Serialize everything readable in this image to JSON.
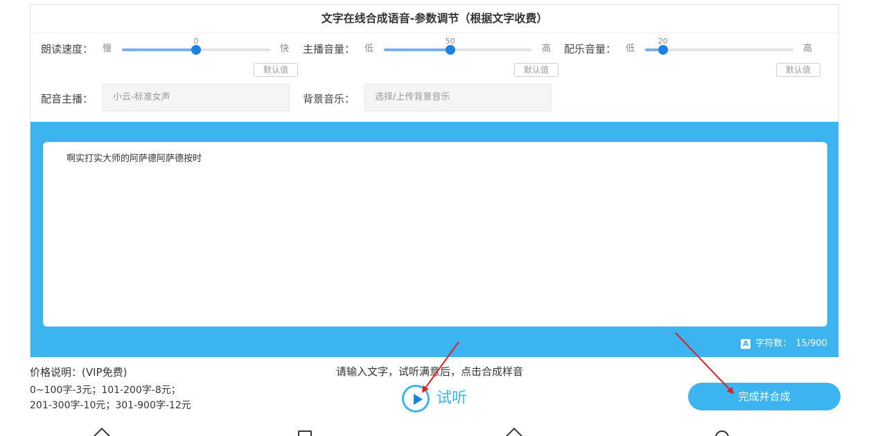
{
  "page_title": "文字在线合成语音-参数调节（根据文字收费）",
  "params": {
    "speed": {
      "label": "朗读速度：",
      "min_label": "慢",
      "max_label": "快",
      "value": "0",
      "level": 0.5,
      "default_label": "默认值"
    },
    "host_volume": {
      "label": "主播音量：",
      "min_label": "低",
      "max_label": "高",
      "value": "50",
      "level": 0.45,
      "default_label": "默认值"
    },
    "music_volume": {
      "label": "配乐音量：",
      "min_label": "低",
      "max_label": "高",
      "value": "20",
      "level": 0.12,
      "default_label": "默认值"
    }
  },
  "voice": {
    "label": "配音主播：",
    "placeholder": "小云-标准女声"
  },
  "bgm": {
    "label": "背景音乐：",
    "placeholder": "选择/上传背景音乐"
  },
  "editor": {
    "text": "啊实打实大师的阿萨德阿萨德按时"
  },
  "counter": {
    "icon_letter": "A",
    "label": "字符数：",
    "value": "15/900"
  },
  "pricing": {
    "title": "价格说明：(VIP免费)",
    "line1": "0~100字-3元；101-200字-8元；",
    "line2": "201-300字-10元；301-900字-12元"
  },
  "hint": "请输入文字，试听满意后，点击合成样音",
  "listen_label": "试听",
  "synth_button": "完成并合成",
  "colors": {
    "accent": "#3cb4ef",
    "slider_knob": "#1a82e0",
    "annotation_arrow": "#e02020"
  },
  "icons": [
    "play-icon",
    "home-icon",
    "document-icon",
    "tag-icon",
    "circle-icon"
  ]
}
